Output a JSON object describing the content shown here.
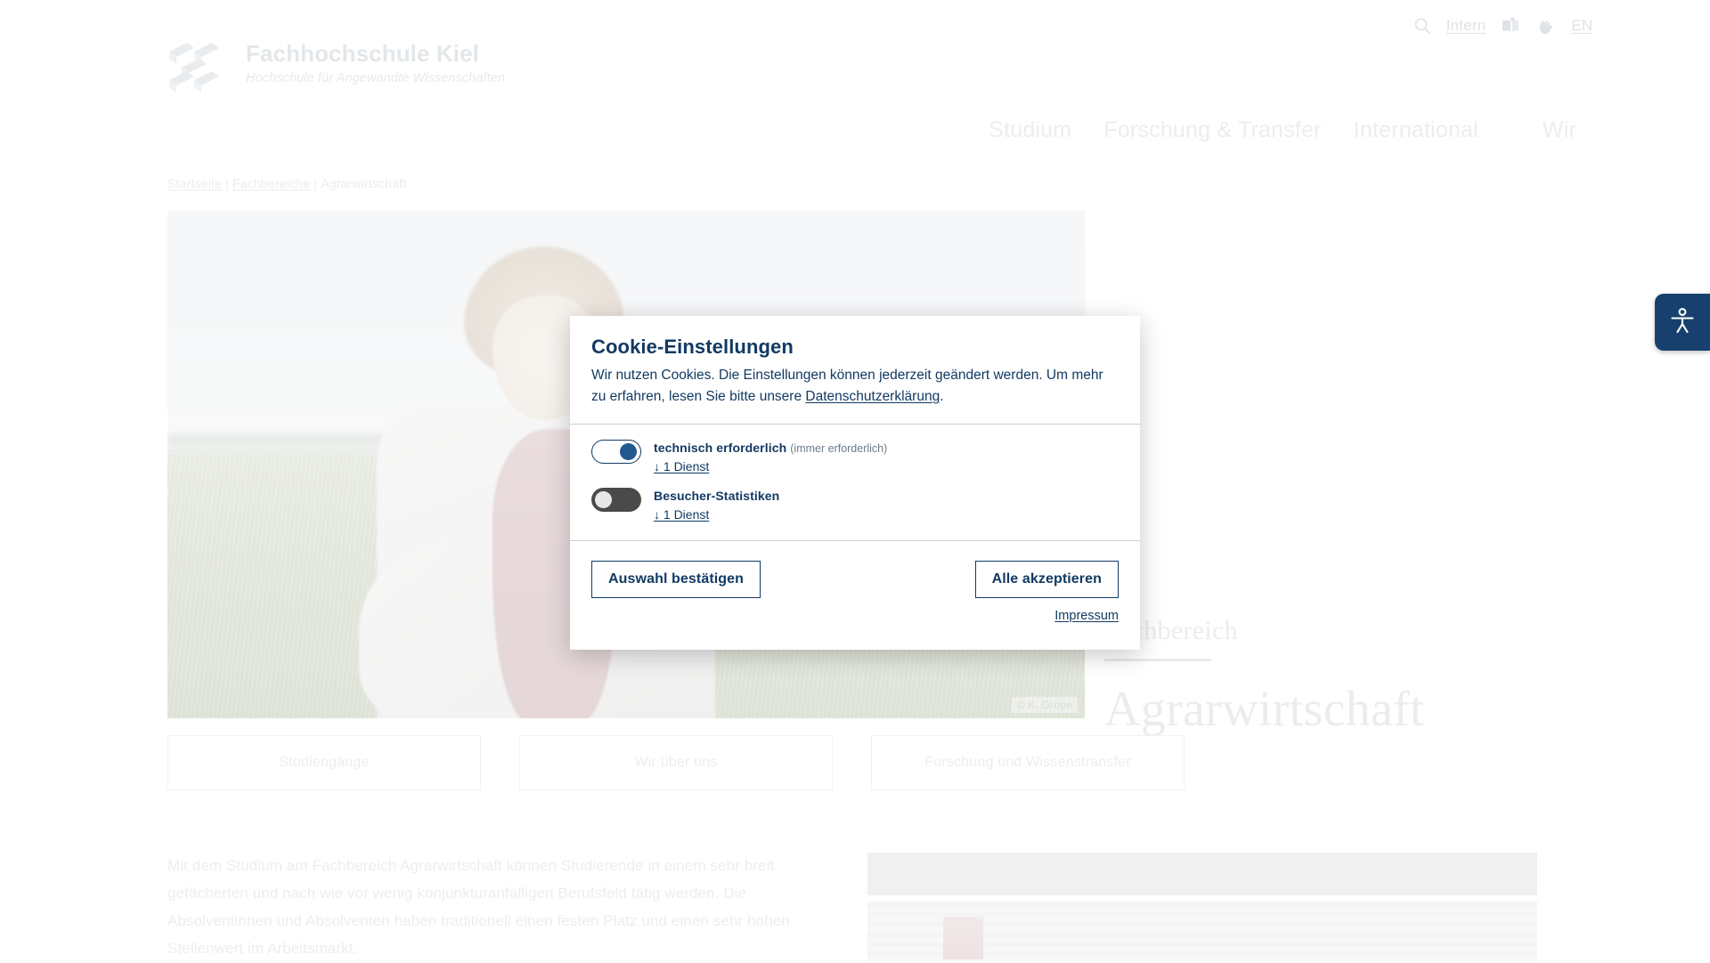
{
  "site": {
    "brand_title": "Fachhochschule Kiel",
    "brand_subtitle": "Hochschule für Angewandte Wissenschaften",
    "brand_color": "#9fb2c8"
  },
  "utility": {
    "search_icon": "search-icon",
    "intern_label": "Intern",
    "easy_language_icon": "easy-language-icon",
    "sign_language_icon": "sign-language-icon",
    "language_label": "EN"
  },
  "nav": {
    "items": [
      {
        "label": "Studium"
      },
      {
        "label": "Forschung & Transfer"
      },
      {
        "label": "International"
      },
      {
        "label": "Wir"
      }
    ]
  },
  "breadcrumb": {
    "home": "Startseite",
    "separator": "|",
    "section": "Fachbereiche",
    "current": "Agrarwirtschaft"
  },
  "hero": {
    "kicker": "Fachbereich",
    "title": "Agrarwirtschaft",
    "copyright": "© K. Grope"
  },
  "cards": [
    {
      "label": "Studiengänge"
    },
    {
      "label": "Wir über uns"
    },
    {
      "label": "Forschung und Wissenstransfer"
    }
  ],
  "content": {
    "paragraph": "Mit dem Studium am Fachbereich Agrarwirtschaft können Studierende in einem sehr breit gefächerten und nach wie vor wenig konjunkturanfälligen Berufsfeld tätig werden. Die Absolventinnen und Absolventen haben traditionell einen festen Platz und einen sehr hohen Stellenwert im Arbeitsmarkt."
  },
  "accessibility_widget": {
    "icon": "accessibility-person-icon",
    "color": "#17406e"
  },
  "cookie_dialog": {
    "title": "Cookie-Einstellungen",
    "description_before_link": "Wir nutzen Cookies. Die Einstellungen können jederzeit geändert werden. Um mehr zu erfahren, lesen Sie bitte unsere ",
    "description_link": "Datenschutzerklärung",
    "description_after_link": ".",
    "categories": [
      {
        "name": "technisch erforderlich",
        "note": "(immer erforderlich)",
        "state": "on",
        "services_label": "↓ 1 Dienst"
      },
      {
        "name": "Besucher-Statistiken",
        "note": "",
        "state": "off",
        "services_label": "↓ 1 Dienst"
      }
    ],
    "confirm_button": "Auswahl bestätigen",
    "accept_all_button": "Alle akzeptieren",
    "imprint_link": "Impressum",
    "accent_color": "#123a63"
  }
}
